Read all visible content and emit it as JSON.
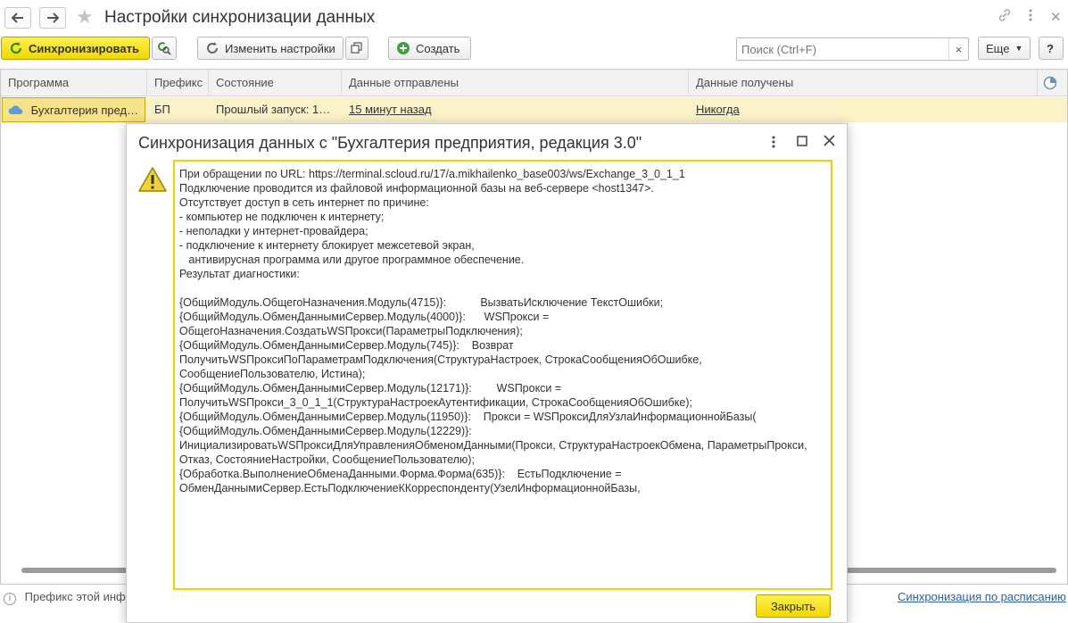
{
  "window": {
    "title": "Настройки синхронизации данных"
  },
  "nav": {
    "back_icon": "arrow-left-icon",
    "forward_icon": "arrow-right-icon",
    "favorite_icon": "star-icon"
  },
  "toolbar": {
    "sync_label": "Синхронизировать",
    "change_settings_label": "Изменить настройки",
    "create_label": "Создать",
    "more_label": "Еще",
    "search_placeholder": "Поиск (Ctrl+F)",
    "search_clear": "×",
    "help_label": "?"
  },
  "table": {
    "columns": [
      "Программа",
      "Префикс",
      "Состояние",
      "Данные отправлены",
      "Данные получены"
    ],
    "rows": [
      {
        "program": "Бухгалтерия пред…",
        "prefix": "БП",
        "state": "Прошлый запуск: 1…",
        "sent": "15 минут назад",
        "received": "Никогда"
      }
    ]
  },
  "footer": {
    "prefix_text": "Префикс этой инфо",
    "schedule_link": "Синхронизация по расписанию"
  },
  "dialog": {
    "title": "Синхронизация данных с \"Бухгалтерия предприятия, редакция 3.0\"",
    "message_lines": [
      "При обращении по URL: https://terminal.scloud.ru/17/a.mikhailenko_base003/ws/Exchange_3_0_1_1",
      "Подключение проводится из файловой информационной базы на веб-сервере <host1347>.",
      "Отсутствует доступ в сеть интернет по причине:",
      "- компьютер не подключен к интернету;",
      "- неполадки у интернет-провайдера;",
      "- подключение к интернету блокирует межсетевой экран,",
      "   антивирусная программа или другое программное обеспечение.",
      "Результат диагностики:",
      "",
      "{ОбщийМодуль.ОбщегоНазначения.Модуль(4715)}:           ВызватьИсключение ТекстОшибки;",
      "{ОбщийМодуль.ОбменДаннымиСервер.Модуль(4000)}:      WSПрокси =",
      "ОбщегоНазначения.СоздатьWSПрокси(ПараметрыПодключения);",
      "{ОбщийМодуль.ОбменДаннымиСервер.Модуль(745)}:    Возврат",
      "ПолучитьWSПроксиПоПараметрамПодключения(СтруктураНастроек, СтрокаСообщенияОбОшибке,",
      "СообщениеПользователю, Истина);",
      "{ОбщийМодуль.ОбменДаннымиСервер.Модуль(12171)}:        WSПрокси =",
      "ПолучитьWSПрокси_3_0_1_1(СтруктураНастроекАутентификации, СтрокаСообщенияОбОшибке);",
      "{ОбщийМодуль.ОбменДаннымиСервер.Модуль(11950)}:    Прокси = WSПроксиДляУзлаИнформационнойБазы(",
      "{ОбщийМодуль.ОбменДаннымиСервер.Модуль(12229)}:",
      "ИнициализироватьWSПроксиДляУправленияОбменомДанными(Прокси, СтруктураНастроекОбмена, ПараметрыПрокси,",
      "Отказ, СостояниеНастройки, СообщениеПользователю);",
      "{Обработка.ВыполнениеОбменаДанными.Форма.Форма(635)}:    ЕстьПодключение =",
      "ОбменДаннымиСервер.ЕстьПодключениеККорреспонденту(УзелИнформационнойБазы,"
    ],
    "close_label": "Закрыть"
  }
}
